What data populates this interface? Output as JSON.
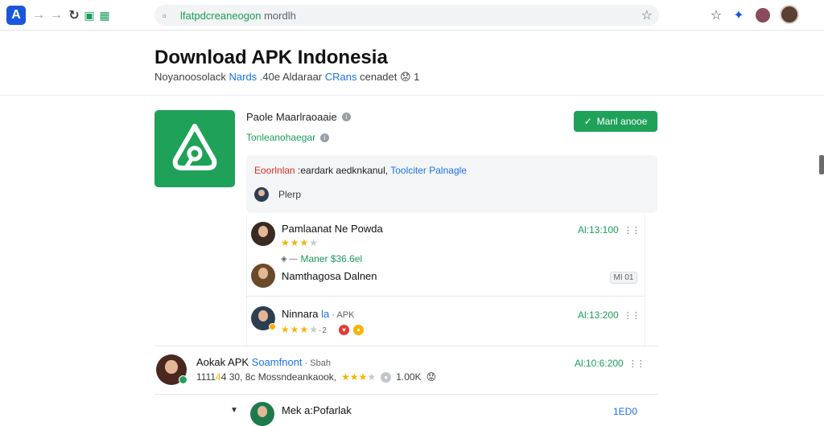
{
  "browser": {
    "url_host": "lfatpdcreaneogon",
    "url_path": " mordlh"
  },
  "page": {
    "title": "Download APK Indonesia",
    "subtitle_a": "Noyanoosolack ",
    "subtitle_b": "Nards",
    "subtitle_c": " .40e  Aldaraar ",
    "subtitle_d": "CRans",
    "subtitle_e": " cenadet 😟 1"
  },
  "app": {
    "developer": "Paole Maarlraoaaie",
    "category": "Tonleanohaegar",
    "install_label": "Manl anooe",
    "notice_red": "Eoorlnlan",
    "notice_mid": " :eardark aedknkanul, ",
    "notice_blue": "Toolciter Palnagle",
    "notice_user": "Plerp"
  },
  "reviews": [
    {
      "name": "Pamlaanat Ne Powda",
      "time": "Al:13:100",
      "rating": 3.5,
      "meta_tag": "◈ —",
      "meta": "Maner $36.6el"
    },
    {
      "name": "Namthagosa Dalnen",
      "chip": "MI 01"
    },
    {
      "name": "Ninnara",
      "name_blue": " la",
      "name_grey": " · APK",
      "time": "Al:13:200",
      "rating": 3.5,
      "stars_tail": "·2"
    },
    {
      "name": "Aokak APK ",
      "name_blue": "Soamfnont",
      "name_grey": " · Sbah",
      "time": "Al:10:6:200",
      "prefix": "1111",
      "prefix_yellow": "4",
      "prefix_tail": "4  30,  8c Mossndeankaook,",
      "rating": 3.5,
      "count": "1.00K",
      "emoji": "😟"
    },
    {
      "name": "Mek a:Pofarlak",
      "time": "1ED0"
    }
  ],
  "colors": {
    "brand_green": "#1fa15a",
    "link_blue": "#1a73e8",
    "star_yellow": "#f4b400",
    "alert_red": "#d93025"
  }
}
